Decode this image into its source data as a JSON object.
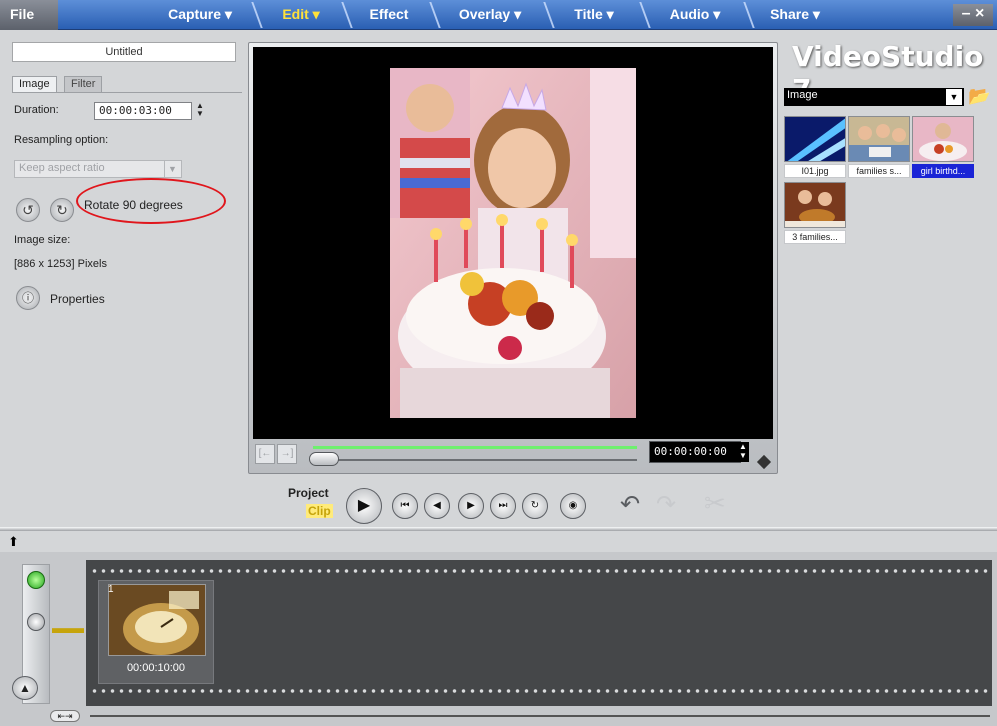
{
  "menubar": {
    "file_label": "File",
    "steps": [
      "Capture ▾",
      "Edit ▾",
      "Effect",
      "Overlay ▾",
      "Title ▾",
      "Audio ▾",
      "Share ▾"
    ],
    "minimize_label": "– ×"
  },
  "options": {
    "project_title": "Untitled",
    "tab_image": "Image",
    "tab_filter": "Filter",
    "duration_label": "Duration:",
    "duration_value": "00:00:03:00",
    "resampling_label": "Resampling option:",
    "resampling_value": "Keep aspect ratio",
    "rotate_label": "Rotate 90 degrees",
    "image_size_label": "Image size:",
    "image_size_value": "[886 x 1253] Pixels",
    "properties_label": "Properties"
  },
  "preview": {
    "timecode": "00:00:00:00"
  },
  "playback": {
    "project_label": "Project",
    "clip_label": "Clip"
  },
  "library": {
    "app_title": "VideoStudio 7",
    "category": "Image",
    "items": [
      {
        "caption": "I01.jpg",
        "selected": false
      },
      {
        "caption": "families s...",
        "selected": false
      },
      {
        "caption": "girl birthd...",
        "selected": true
      },
      {
        "caption": "3 families...",
        "selected": false
      }
    ]
  },
  "timeline": {
    "clip_number": "1",
    "clip_duration": "00:00:10:00"
  },
  "colors": {
    "accent_red": "#e0161c",
    "menu_blue": "#2a5fb3",
    "selection_blue": "#1a24d6"
  }
}
